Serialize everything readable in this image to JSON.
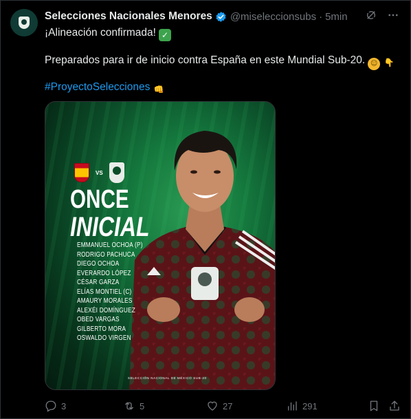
{
  "tweet": {
    "display_name": "Selecciones Nacionales Menores",
    "handle": "@miseleccionsubs",
    "separator": "·",
    "time": "5min",
    "text_line1": "¡Alineación confirmada!",
    "text_line2": "Preparados para ir de inicio contra España en este Mundial Sub-20.",
    "hashtag": "#ProyectoSelecciones",
    "emojis": {
      "check": "✓",
      "face": "☺",
      "point": "👇",
      "fist": "👊"
    }
  },
  "media": {
    "vs": "VS",
    "title_line1": "ONCE",
    "title_line2": "INICIAL",
    "players": [
      "EMMANUEL OCHOA (P)",
      "RODRIGO PACHUCA",
      "DIEGO OCHOA",
      "EVERARDO LÓPEZ",
      "CÉSAR GARZA",
      "ELÍAS MONTIEL (C)",
      "AMAURY MORALES",
      "ALEXÉI DOMÍNGUEZ",
      "OBED VARGAS",
      "GILBERTO MORA",
      "OSWALDO VIRGEN"
    ],
    "footer": "SELECCIÓN NACIONAL DE MÉXICO SUB-20"
  },
  "actions": {
    "replies": "3",
    "retweets": "5",
    "likes": "27",
    "views": "291"
  },
  "colors": {
    "background": "#000000",
    "text": "#e7e9ea",
    "muted": "#71767b",
    "link": "#1d9bf0",
    "verified": "#1d9bf0"
  }
}
